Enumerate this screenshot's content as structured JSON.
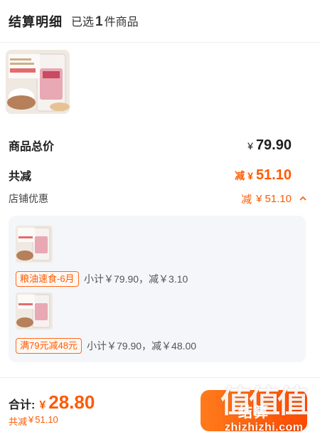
{
  "header": {
    "title": "结算明细",
    "selected_prefix": "已选",
    "selected_count": "1",
    "selected_suffix": "件商品"
  },
  "summary": {
    "total_label": "商品总价",
    "total_currency": "¥",
    "total_value": "79.90",
    "reduce_label": "共减",
    "reduce_prefix": "减",
    "reduce_currency": "¥",
    "reduce_value": "51.10",
    "shop_label": "店铺优惠",
    "shop_prefix": "减",
    "shop_currency": "¥",
    "shop_value": "51.10",
    "shop_toggle_icon": "chevron-up-icon"
  },
  "promos": [
    {
      "tag": "粮油速食-6月",
      "subtotal": "小计￥79.90，减￥3.10"
    },
    {
      "tag": "满79元减48元",
      "subtotal": "小计￥79.90，减￥48.00"
    }
  ],
  "footer": {
    "total_label": "合计:",
    "total_currency": "¥",
    "total_value": "28.80",
    "reduce_label": "共减",
    "reduce_currency": "¥",
    "reduce_value": "51.10",
    "checkout_label": "结算"
  },
  "watermark": {
    "mark": "值值值",
    "site": "zhizhizhi.com"
  },
  "colors": {
    "accent": "#ff5a00",
    "panel_bg": "#f4f6f9",
    "text_main": "#1f1f1f"
  }
}
